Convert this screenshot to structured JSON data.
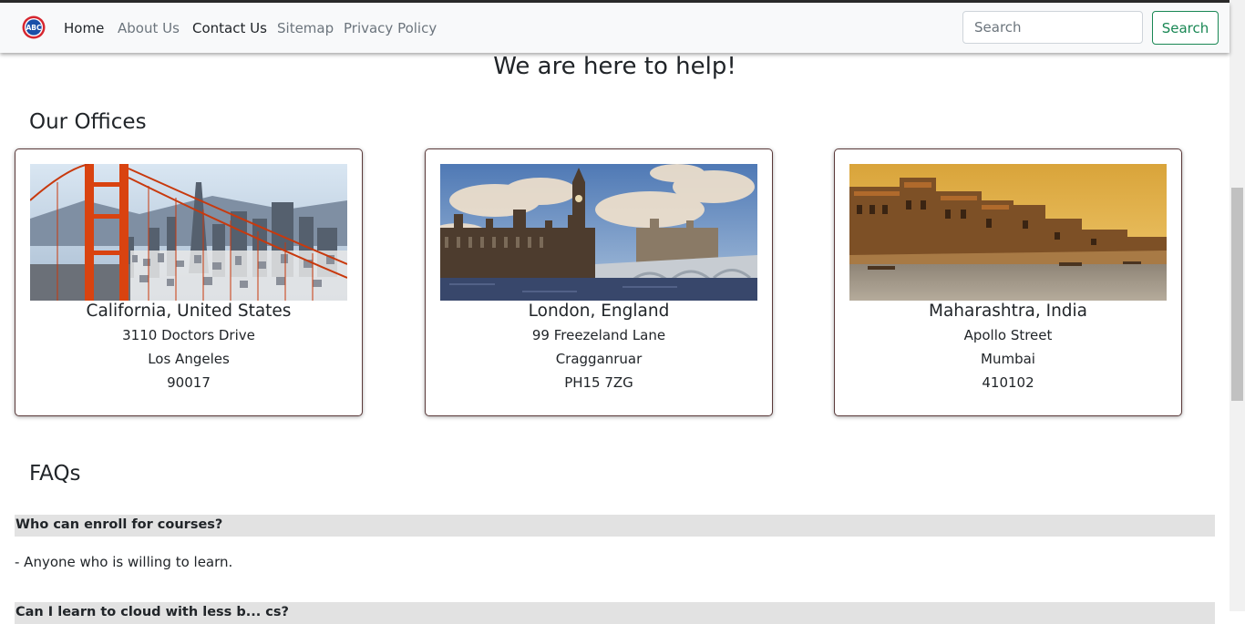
{
  "nav": {
    "logo_text": "ABC",
    "links": [
      "Home",
      "About Us",
      "Contact Us",
      "Sitemap",
      "Privacy Policy"
    ],
    "search_placeholder": "Search",
    "search_button": "Search",
    "accent_color": "#198754"
  },
  "page": {
    "title": "We are here to help!"
  },
  "offices": {
    "heading": "Our Offices",
    "cards": [
      {
        "image": "golden-gate-bridge-san-francisco",
        "title": "California, United States",
        "line1": "3110 Doctors Drive",
        "line2": "Los Angeles",
        "line3": "90017"
      },
      {
        "image": "big-ben-westminster-london",
        "title": "London, England",
        "line1": "99 Freezeland Lane",
        "line2": "Cragganruar",
        "line3": "PH15 7ZG"
      },
      {
        "image": "varanasi-ghats-india",
        "title": "Maharashtra, India",
        "line1": "Apollo Street",
        "line2": "Mumbai",
        "line3": "410102"
      }
    ]
  },
  "faqs": {
    "heading": "FAQs",
    "items": [
      {
        "question": "Who can enroll for courses?",
        "answer": "- Anyone who is willing to learn."
      },
      {
        "question": "Can I learn to cloud with less b... cs?",
        "answer": ""
      }
    ]
  }
}
